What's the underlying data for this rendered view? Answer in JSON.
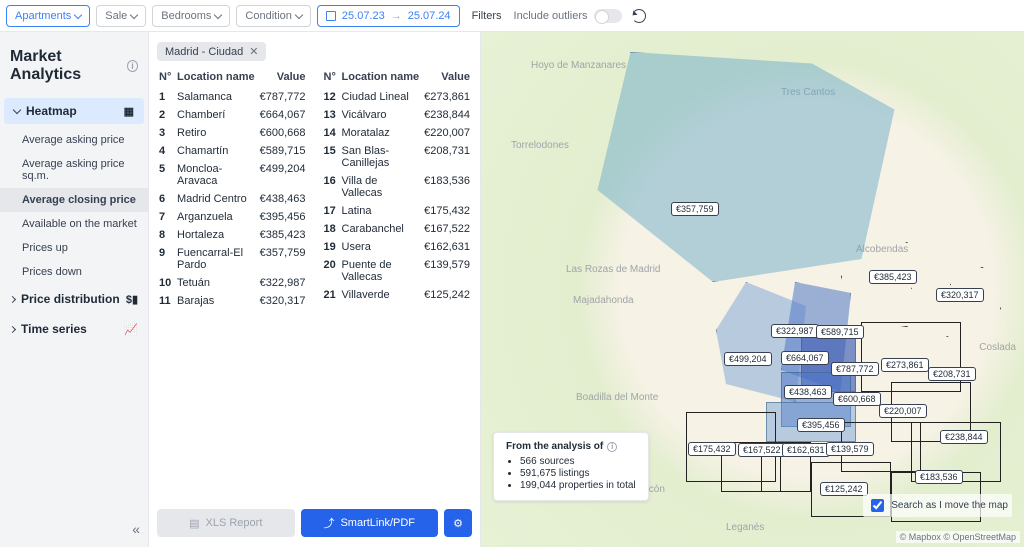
{
  "topbar": {
    "apartments": "Apartments",
    "sale": "Sale",
    "bedrooms": "Bedrooms",
    "condition": "Condition",
    "date_from": "25.07.23",
    "date_to": "25.07.24",
    "filters": "Filters",
    "include_outliers": "Include outliers"
  },
  "sidebar": {
    "title": "Market Analytics",
    "heatmap": "Heatmap",
    "items": {
      "avg_ask": "Average asking price",
      "avg_ask_sqm": "Average asking price sq.m.",
      "avg_close": "Average closing price",
      "available": "Available on the market",
      "prices_up": "Prices up",
      "prices_down": "Prices down"
    },
    "price_dist": "Price distribution",
    "time_series": "Time series"
  },
  "chip": {
    "label": "Madrid - Ciudad"
  },
  "table": {
    "h_no": "N°",
    "h_name": "Location name",
    "h_value": "Value",
    "left": [
      {
        "n": "1",
        "name": "Salamanca",
        "value": "€787,772"
      },
      {
        "n": "2",
        "name": "Chamberí",
        "value": "€664,067"
      },
      {
        "n": "3",
        "name": "Retiro",
        "value": "€600,668"
      },
      {
        "n": "4",
        "name": "Chamartín",
        "value": "€589,715"
      },
      {
        "n": "5",
        "name": "Moncloa-Aravaca",
        "value": "€499,204"
      },
      {
        "n": "6",
        "name": "Madrid Centro",
        "value": "€438,463"
      },
      {
        "n": "7",
        "name": "Arganzuela",
        "value": "€395,456"
      },
      {
        "n": "8",
        "name": "Hortaleza",
        "value": "€385,423"
      },
      {
        "n": "9",
        "name": "Fuencarral-El Pardo",
        "value": "€357,759"
      },
      {
        "n": "10",
        "name": "Tetuán",
        "value": "€322,987"
      },
      {
        "n": "11",
        "name": "Barajas",
        "value": "€320,317"
      }
    ],
    "right": [
      {
        "n": "12",
        "name": "Ciudad Lineal",
        "value": "€273,861"
      },
      {
        "n": "13",
        "name": "Vicálvaro",
        "value": "€238,844"
      },
      {
        "n": "14",
        "name": "Moratalaz",
        "value": "€220,007"
      },
      {
        "n": "15",
        "name": "San Blas-Canillejas",
        "value": "€208,731"
      },
      {
        "n": "16",
        "name": "Villa de Vallecas",
        "value": "€183,536"
      },
      {
        "n": "17",
        "name": "Latina",
        "value": "€175,432"
      },
      {
        "n": "18",
        "name": "Carabanchel",
        "value": "€167,522"
      },
      {
        "n": "19",
        "name": "Usera",
        "value": "€162,631"
      },
      {
        "n": "20",
        "name": "Puente de Vallecas",
        "value": "€139,579"
      },
      {
        "n": "21",
        "name": "Villaverde",
        "value": "€125,242"
      }
    ]
  },
  "footer": {
    "xls": "XLS Report",
    "smart": "SmartLink/PDF"
  },
  "map": {
    "places": {
      "hoyo": "Hoyo de Manzanares",
      "tres": "Tres Cantos",
      "torre": "Torrelodones",
      "rozas": "Las Rozas de Madrid",
      "majada": "Majadahonda",
      "alcobendas": "Alcobendas",
      "coslada": "Coslada",
      "boadilla": "Boadilla del Monte",
      "alcorcon": "Alcorcón",
      "leganes": "Leganés"
    },
    "tags": {
      "t357": "€357,759",
      "t385": "€385,423",
      "t320": "€320,317",
      "t322": "€322,987",
      "t589": "€589,715",
      "t499": "€499,204",
      "t664": "€664,067",
      "t787": "€787,772",
      "t208": "€208,731",
      "t438": "€438,463",
      "t600": "€600,668",
      "t220": "€220,007",
      "t395": "€395,456",
      "t238": "€238,844",
      "t175": "€175,432",
      "t167": "€167,522",
      "t162": "€162,631",
      "t139": "€139,579",
      "t125": "€125,242",
      "t183": "€183,536",
      "t273": "€273,861"
    },
    "analysis": {
      "title": "From the analysis of",
      "l1": "566 sources",
      "l2": "591,675 listings",
      "l3": "199,044 properties in total"
    },
    "search_move": "Search as I move the map",
    "attrib": "© Mapbox © OpenStreetMap"
  }
}
